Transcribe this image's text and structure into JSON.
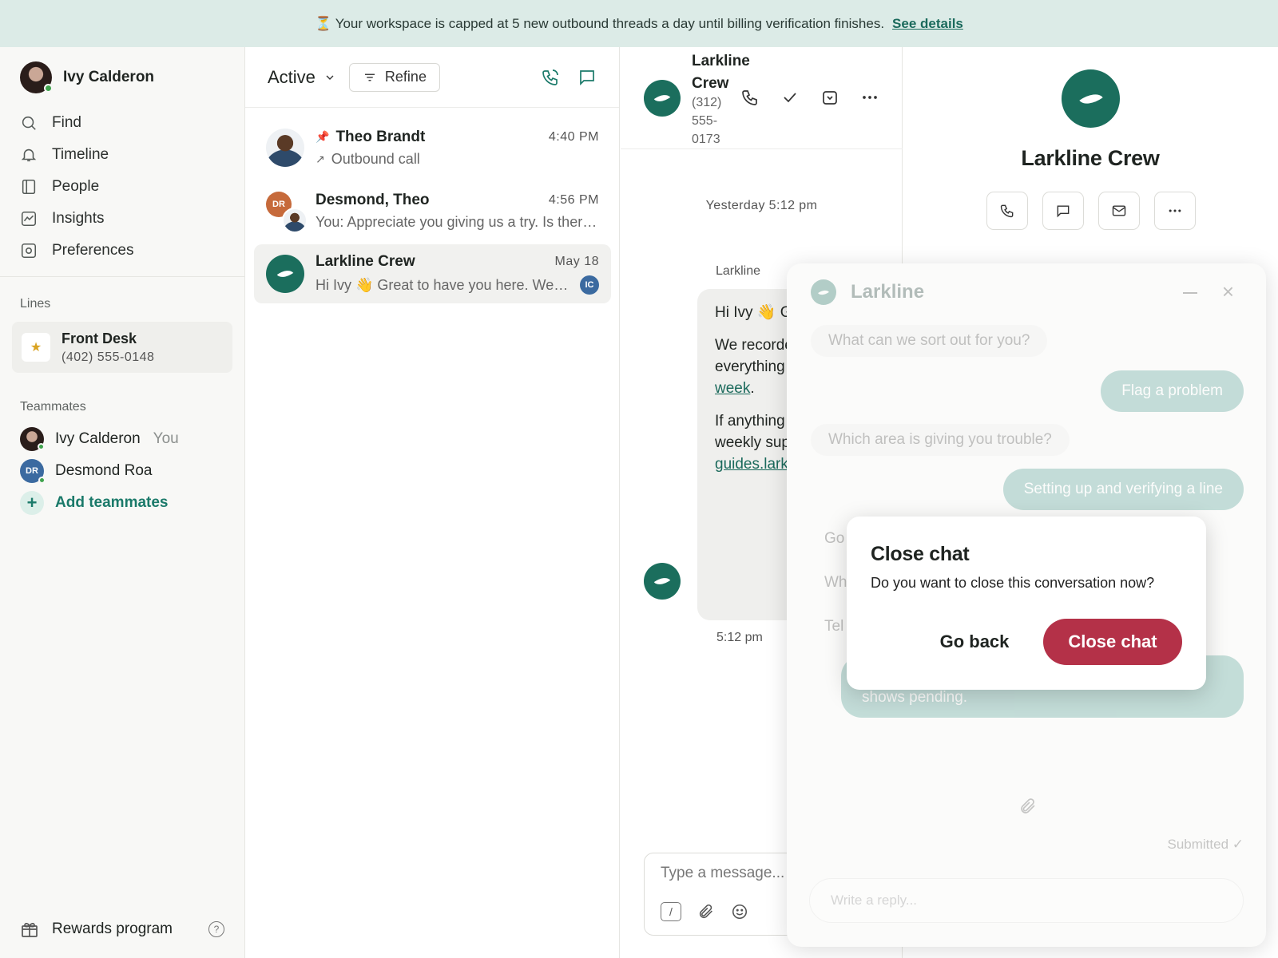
{
  "banner": {
    "icon": "hourglass-icon",
    "text": "⏳ Your workspace is capped at 5 new outbound threads a day until billing verification finishes.",
    "link": "See details"
  },
  "sidebar": {
    "user_name": "Ivy Calderon",
    "nav": [
      {
        "label": "Find",
        "icon": "search-icon"
      },
      {
        "label": "Timeline",
        "icon": "bell-icon"
      },
      {
        "label": "People",
        "icon": "contacts-icon"
      },
      {
        "label": "Insights",
        "icon": "chart-icon"
      },
      {
        "label": "Preferences",
        "icon": "settings-icon"
      }
    ],
    "lines_label": "Lines",
    "line": {
      "name": "Front Desk",
      "number": "(402) 555-0148",
      "icon": "star-icon"
    },
    "teammates_label": "Teammates",
    "teammates": [
      {
        "name": "Ivy Calderon",
        "tag": "You"
      },
      {
        "name": "Desmond Roa",
        "initials": "DR"
      }
    ],
    "add_teammates": "Add teammates",
    "rewards": "Rewards program",
    "help_glyph": "?"
  },
  "list": {
    "filter": "Active",
    "refine": "Refine",
    "conversations": [
      {
        "name": "Theo Brandt",
        "time": "4:40 PM",
        "preview": "Outbound call",
        "pinned": true
      },
      {
        "name": "Desmond, Theo",
        "time": "4:56 PM",
        "preview": "You: Appreciate you giving us a try. Is there anything else we can help with?",
        "initials": "DR"
      },
      {
        "name": "Larkline Crew",
        "time": "May 18",
        "preview": "Hi Ivy 👋 Great to have you here. We recorded a short walkthrough",
        "badge": "IC"
      }
    ]
  },
  "thread": {
    "name": "Larkline Crew",
    "number": "(312) 555-0173",
    "date_separator": "Yesterday 5:12 pm",
    "sender": "Larkline",
    "message": {
      "p1": "Hi Ivy 👋 Great to have you on board.",
      "p2_start": "We recorded a short walkthrough that covers everything you need in one: ",
      "p2_link": "larkline.com/first-week",
      "p3_start": "If anything comes up, our written guides and weekly support hours are listed at ",
      "p3_link": "guides.larkline.com"
    },
    "time": "5:12 pm",
    "composer_placeholder": "Type a message...",
    "slash": "/"
  },
  "contact": {
    "name": "Larkline Crew"
  },
  "widget": {
    "title": "Larkline",
    "minimize_glyph": "–",
    "close_glyph": "×",
    "q1": "What can we sort out for you?",
    "a1": "Flag a problem",
    "q2": "Which area is giving you trouble?",
    "a2": "Setting up and verifying a line",
    "partial1": "Go",
    "partial2": "Wh",
    "partial3": "Tel",
    "a3": "shows pending.",
    "submitted": "Submitted ✓",
    "reply_placeholder": "Write a reply..."
  },
  "dialog": {
    "title": "Close chat",
    "text": "Do you want to close this conversation now?",
    "back": "Go back",
    "confirm": "Close chat",
    "confirm_color": "#b43148"
  },
  "colors": {
    "accent": "#1b6e5d",
    "banner_bg": "#dcebe7",
    "danger": "#b43148"
  }
}
